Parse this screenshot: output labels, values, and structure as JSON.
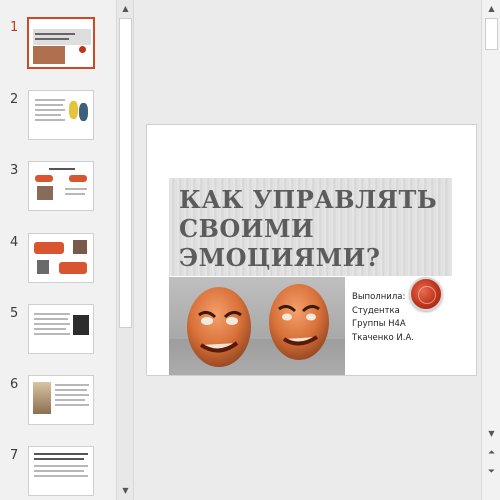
{
  "thumbnails": [
    {
      "number": "1",
      "active": true
    },
    {
      "number": "2",
      "active": false
    },
    {
      "number": "3",
      "active": false
    },
    {
      "number": "4",
      "active": false
    },
    {
      "number": "5",
      "active": false
    },
    {
      "number": "6",
      "active": false
    },
    {
      "number": "7",
      "active": false
    }
  ],
  "slide": {
    "title": "КАК УПРАВЛЯТЬ СВОИМИ ЭМОЦИЯМИ?",
    "subtitle_lines": [
      "Выполнила:",
      "Студентка",
      "Группы Н4А",
      "Ткаченко И.А."
    ]
  },
  "scrollbars": {
    "up_icon": "triangle-up",
    "down_icon": "triangle-down",
    "prev_slide_icon": "double-up",
    "next_slide_icon": "double-down"
  },
  "colors": {
    "accent": "#d24726",
    "title_text": "#5c5c5c"
  }
}
